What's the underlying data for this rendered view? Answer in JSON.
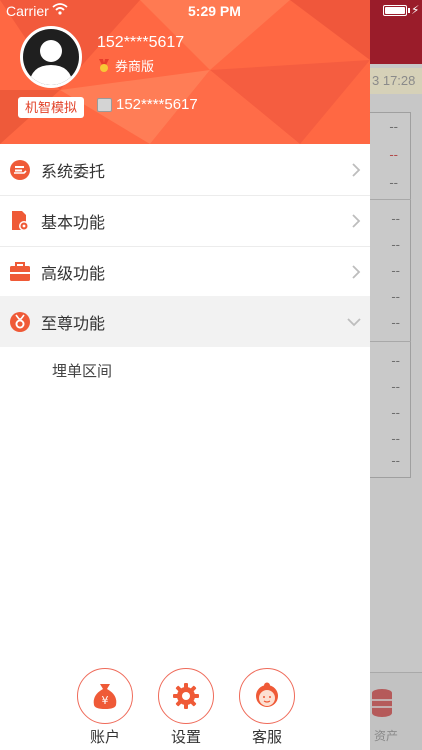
{
  "status_bar": {
    "carrier": "Carrier",
    "time": "5:29 PM"
  },
  "profile": {
    "phone_masked": "152****5617",
    "edition": "券商版",
    "sim_button": "机智模拟",
    "account_masked": "152****5617"
  },
  "menu": {
    "items": [
      {
        "label": "系统委托"
      },
      {
        "label": "基本功能"
      },
      {
        "label": "高级功能"
      },
      {
        "label": "至尊功能"
      }
    ],
    "sub_items": [
      {
        "label": "埋单区间"
      }
    ]
  },
  "bottom": {
    "buttons": [
      {
        "label": "账户"
      },
      {
        "label": "设置"
      },
      {
        "label": "客服"
      }
    ]
  },
  "background": {
    "time_text": "3 17:28",
    "cells": [
      "--",
      "--",
      "--",
      "--",
      "--",
      "--",
      "--",
      "--",
      "--",
      "--",
      "--",
      "--",
      "--"
    ],
    "asset_label": "资产"
  },
  "colors": {
    "accent": "#ff6a43",
    "accent_dark": "#e2432a"
  }
}
